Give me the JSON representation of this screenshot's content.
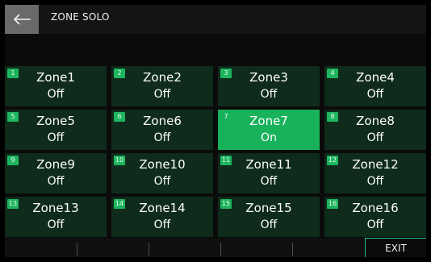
{
  "header": {
    "title": "ZONE SOLO",
    "back_icon": "arrow-left-icon"
  },
  "zones": [
    {
      "number": "1",
      "name": "Zone1",
      "state": "Off"
    },
    {
      "number": "2",
      "name": "Zone2",
      "state": "Off"
    },
    {
      "number": "3",
      "name": "Zone3",
      "state": "Off"
    },
    {
      "number": "4",
      "name": "Zone4",
      "state": "Off"
    },
    {
      "number": "5",
      "name": "Zone5",
      "state": "Off"
    },
    {
      "number": "6",
      "name": "Zone6",
      "state": "Off"
    },
    {
      "number": "7",
      "name": "Zone7",
      "state": "On"
    },
    {
      "number": "8",
      "name": "Zone8",
      "state": "Off"
    },
    {
      "number": "9",
      "name": "Zone9",
      "state": "Off"
    },
    {
      "number": "10",
      "name": "Zone10",
      "state": "Off"
    },
    {
      "number": "11",
      "name": "Zone11",
      "state": "Off"
    },
    {
      "number": "12",
      "name": "Zone12",
      "state": "Off"
    },
    {
      "number": "13",
      "name": "Zone13",
      "state": "Off"
    },
    {
      "number": "14",
      "name": "Zone14",
      "state": "Off"
    },
    {
      "number": "15",
      "name": "Zone15",
      "state": "Off"
    },
    {
      "number": "16",
      "name": "Zone16",
      "state": "Off"
    }
  ],
  "footer": {
    "exit_label": "EXIT"
  },
  "colors": {
    "background": "#000000",
    "zone_off": "#0e2b1b",
    "zone_on": "#18b25b",
    "zone_number_badge": "#1eb55f",
    "back_button": "#6a6a6a",
    "exit_outline": "#1fbd8b"
  }
}
